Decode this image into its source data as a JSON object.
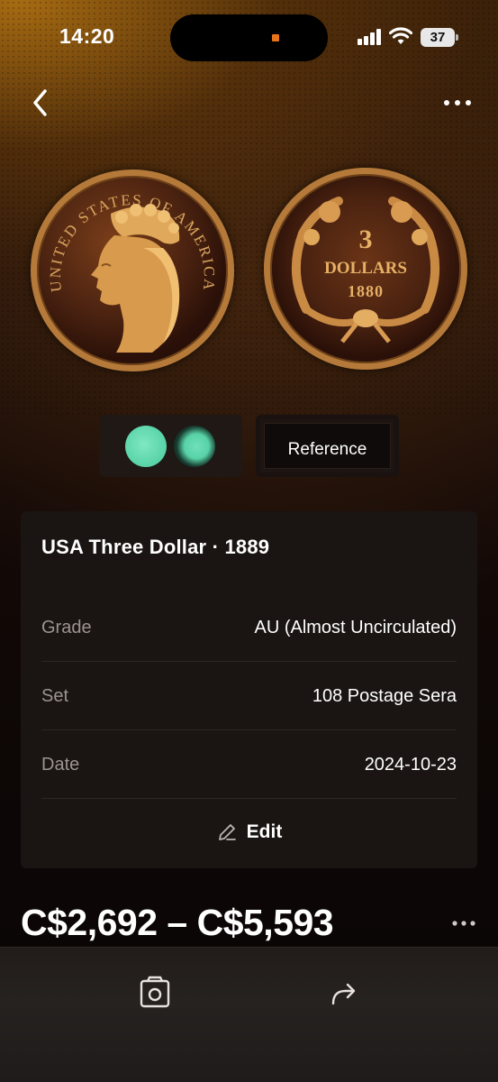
{
  "status_bar": {
    "time": "14:20",
    "battery": "37"
  },
  "coin": {
    "title": "USA Three Dollar · 1889",
    "obverse_legend": "UNITED STATES OF AMERICA",
    "reverse_value": "3",
    "reverse_denomination": "DOLLARS",
    "reverse_year": "1880"
  },
  "toggle": {
    "reference_label": "Reference"
  },
  "details": [
    {
      "label": "Grade",
      "value": "AU (Almost Uncirculated)"
    },
    {
      "label": "Set",
      "value": "108 Postage Sera"
    },
    {
      "label": "Date",
      "value": "2024-10-23"
    }
  ],
  "edit_label": "Edit",
  "price_range": "C$2,692 – C$5,593",
  "icons": {
    "back": "chevron-left-icon",
    "more": "ellipsis-icon",
    "photo": "photo-frame-icon",
    "share": "share-arrow-icon"
  },
  "colors": {
    "accent_green": "#58d2a7",
    "gold": "#b57a3a"
  }
}
